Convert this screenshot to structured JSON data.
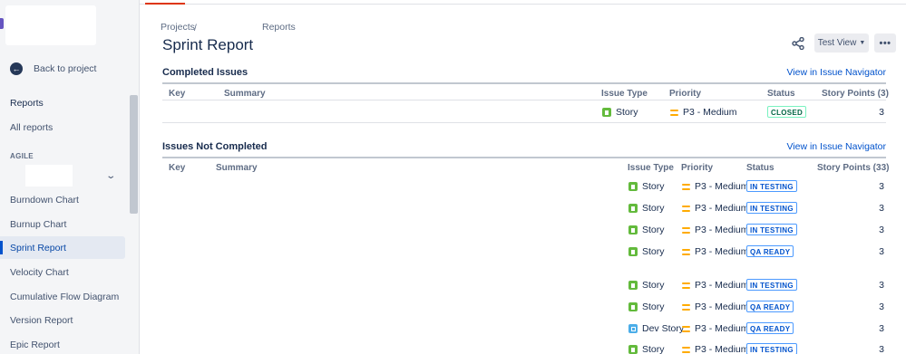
{
  "sidebar": {
    "back_label": "Back to project",
    "reports_heading": "Reports",
    "all_reports": "All reports",
    "section_label": "AGILE",
    "items": [
      {
        "label": "Burndown Chart",
        "active": false
      },
      {
        "label": "Burnup Chart",
        "active": false
      },
      {
        "label": "Sprint Report",
        "active": true
      },
      {
        "label": "Velocity Chart",
        "active": false
      },
      {
        "label": "Cumulative Flow Diagram",
        "active": false
      },
      {
        "label": "Version Report",
        "active": false
      },
      {
        "label": "Epic Report",
        "active": false
      }
    ]
  },
  "header": {
    "breadcrumb_1": "Projects",
    "breadcrumb_sep": "/",
    "breadcrumb_2": "Reports",
    "title": "Sprint Report",
    "view_button": "Test View",
    "more_button": "•••"
  },
  "columns": {
    "key": "Key",
    "summary": "Summary",
    "issue_type": "Issue Type",
    "priority": "Priority",
    "status": "Status"
  },
  "completed": {
    "title": "Completed Issues",
    "link": "View in Issue Navigator",
    "story_points_header": "Story Points (3)",
    "rows": [
      {
        "type": "Story",
        "priority": "P3 - Medium",
        "status": "CLOSED",
        "points": "3"
      }
    ]
  },
  "not_completed": {
    "title": "Issues Not Completed",
    "link": "View in Issue Navigator",
    "story_points_header": "Story Points (33)",
    "rows": [
      {
        "type": "Story",
        "priority": "P3 - Medium",
        "status": "IN TESTING",
        "points": "3"
      },
      {
        "type": "Story",
        "priority": "P3 - Medium",
        "status": "IN TESTING",
        "points": "3"
      },
      {
        "type": "Story",
        "priority": "P3 - Medium",
        "status": "IN TESTING",
        "points": "3"
      },
      {
        "type": "Story",
        "priority": "P3 - Medium",
        "status": "QA READY",
        "points": "3"
      },
      {
        "type": "Story",
        "priority": "P3 - Medium",
        "status": "IN TESTING",
        "points": "3"
      },
      {
        "type": "Story",
        "priority": "P3 - Medium",
        "status": "QA READY",
        "points": "3"
      },
      {
        "type": "Dev Story",
        "priority": "P3 - Medium",
        "status": "QA READY",
        "points": "3"
      },
      {
        "type": "Story",
        "priority": "P3 - Medium",
        "status": "IN TESTING",
        "points": "3"
      }
    ]
  },
  "colors": {
    "accent": "#0052cc",
    "active_tab_marker": "#de350b",
    "story_icon": "#63ba3c",
    "dev_story_icon": "#4bade8",
    "priority_medium": "#ffab00"
  },
  "icons": {
    "back": "arrow-left-icon",
    "share": "share-icon",
    "chevron": "chevron-down-icon",
    "story": "story-icon",
    "dev_story": "dev-story-icon",
    "priority": "priority-medium-icon"
  }
}
